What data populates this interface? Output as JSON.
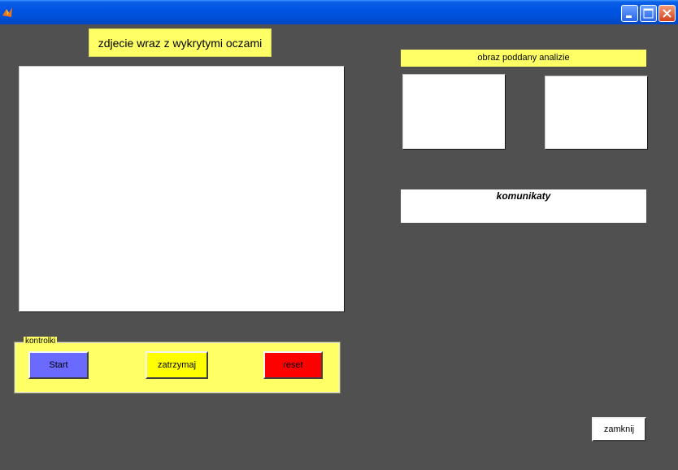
{
  "window": {
    "title": "",
    "colors": {
      "background": "#505050",
      "label_bg": "#ffff66",
      "start": "#6a6aff",
      "stop": "#ffff00",
      "reset": "#ff0000"
    }
  },
  "main": {
    "image_title": "zdjecie wraz z wykrytymi oczami"
  },
  "analysis": {
    "title": "obraz poddany analizie"
  },
  "messages": {
    "title": "komunikaty"
  },
  "controls": {
    "title": "kontrolki",
    "start_label": "Start",
    "stop_label": "zatrzymaj",
    "reset_label": "reset"
  },
  "footer": {
    "close_label": "zamknij"
  },
  "icons": [
    "matlab-app-icon",
    "minimize-icon",
    "maximize-icon",
    "close-icon"
  ]
}
